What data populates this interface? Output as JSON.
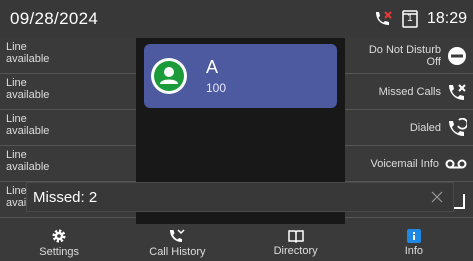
{
  "status": {
    "date": "09/28/2024",
    "time": "18:29",
    "icons": [
      "missed-call-indicator-icon",
      "line-1-badge-icon"
    ],
    "line_badge": "1"
  },
  "line_keys": [
    {
      "label_line1": "Line",
      "label_line2": "available"
    },
    {
      "label_line1": "Line",
      "label_line2": "available"
    },
    {
      "label_line1": "Line",
      "label_line2": "available"
    },
    {
      "label_line1": "Line",
      "label_line2": "available"
    },
    {
      "label_line1": "Line",
      "label_line2": "available"
    }
  ],
  "contact": {
    "name": "A",
    "number": "100",
    "icon": "person-avatar-icon"
  },
  "function_keys": [
    {
      "label_line1": "Do Not Disturb",
      "label_line2": "Off",
      "icon": "dnd-icon"
    },
    {
      "label_line1": "Missed Calls",
      "label_line2": "",
      "icon": "missed-calls-icon"
    },
    {
      "label_line1": "Dialed",
      "label_line2": "",
      "icon": "dialed-calls-icon"
    },
    {
      "label_line1": "Voicemail Info",
      "label_line2": "",
      "icon": "voicemail-icon"
    },
    {
      "label_line1": "",
      "label_line2": "",
      "icon": "more-icon"
    }
  ],
  "toast": {
    "text": "Missed: 2",
    "close_icon": "close-icon"
  },
  "nav": [
    {
      "label": "Settings",
      "icon": "gear-icon"
    },
    {
      "label": "Call History",
      "icon": "call-history-icon"
    },
    {
      "label": "Directory",
      "icon": "book-icon"
    },
    {
      "label": "Info",
      "icon": "info-icon"
    }
  ],
  "colors": {
    "status_bar": "#383838",
    "panel": "#3a3a3a",
    "contact_card": "#4e5aa0",
    "avatar_green": "#1b9b3a",
    "missed_red": "#e53935",
    "info_blue": "#1e88e5"
  }
}
